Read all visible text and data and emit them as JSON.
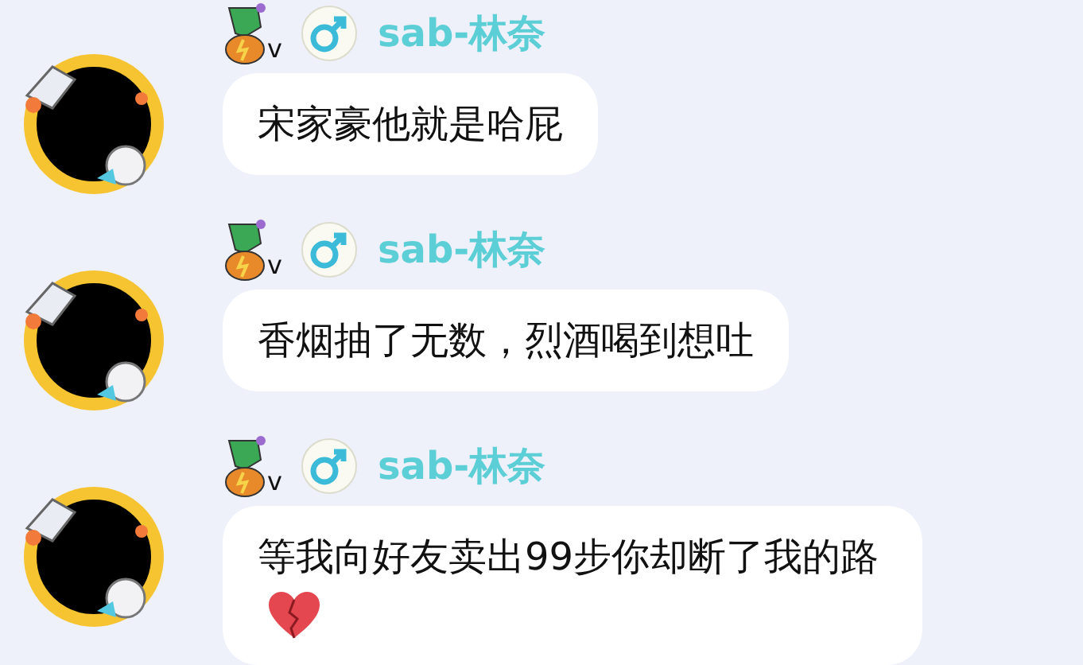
{
  "messages": [
    {
      "level_badge": "v",
      "sender": "sab-林奈",
      "text": "宋家豪他就是哈屁",
      "emoji": false
    },
    {
      "level_badge": "v",
      "sender": "sab-林奈",
      "text": "香烟抽了无数，烈酒喝到想吐",
      "emoji": false
    },
    {
      "level_badge": "v",
      "sender": "sab-林奈",
      "text": "等我向好友卖出99步你却断了我的路",
      "emoji": true
    }
  ]
}
